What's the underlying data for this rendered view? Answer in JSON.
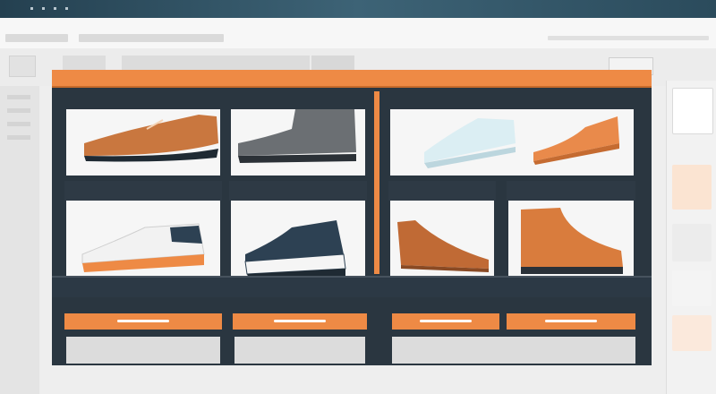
{
  "window": {
    "title": ""
  },
  "gallery": {
    "cards": [
      {
        "id": "brown-oxford",
        "label": ""
      },
      {
        "id": "grey-boot",
        "label": ""
      },
      {
        "id": "white-sneaker-outline",
        "label": ""
      },
      {
        "id": "tan-loafer-top",
        "label": ""
      },
      {
        "id": "white-orange-sneaker",
        "label": ""
      },
      {
        "id": "navy-platform-sneaker",
        "label": ""
      },
      {
        "id": "brown-loafer",
        "label": ""
      },
      {
        "id": "tan-work-boot",
        "label": ""
      }
    ]
  },
  "colors": {
    "accent": "#ee8a45",
    "frame": "#2a3640",
    "background": "#eeeeee",
    "titlebar": "#2a4354"
  }
}
